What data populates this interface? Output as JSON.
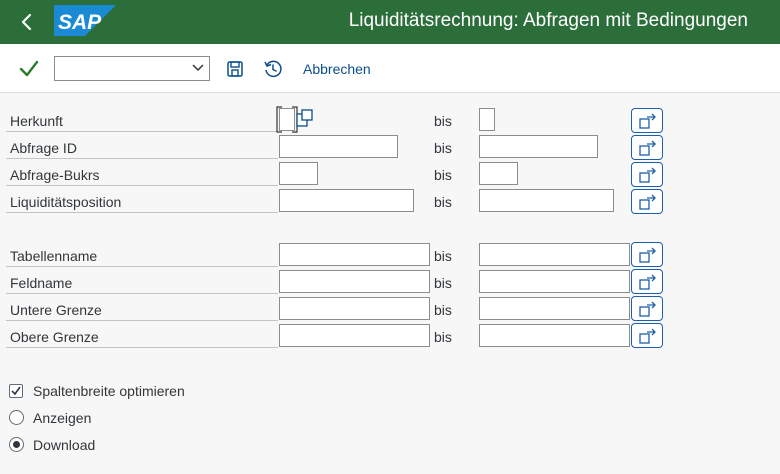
{
  "header": {
    "title": "Liquiditätsrechnung: Abfragen mit Bedingungen",
    "logo_text": "SAP"
  },
  "toolbar": {
    "variant_value": "",
    "cancel_label": "Abbrechen"
  },
  "range_label": "bis",
  "fields": {
    "herkunft": {
      "label": "Herkunft",
      "from": "",
      "to": ""
    },
    "abfrage_id": {
      "label": "Abfrage ID",
      "from": "",
      "to": ""
    },
    "abfrage_bukrs": {
      "label": "Abfrage-Bukrs",
      "from": "",
      "to": ""
    },
    "liquiditaetsposition": {
      "label": "Liquiditätsposition",
      "from": "",
      "to": ""
    },
    "tabellenname": {
      "label": "Tabellenname",
      "from": "",
      "to": ""
    },
    "feldname": {
      "label": "Feldname",
      "from": "",
      "to": ""
    },
    "untere_grenze": {
      "label": "Untere Grenze",
      "from": "",
      "to": ""
    },
    "obere_grenze": {
      "label": "Obere Grenze",
      "from": "",
      "to": ""
    }
  },
  "options": {
    "optimize_columns": {
      "label": "Spaltenbreite optimieren",
      "checked": true
    },
    "display": {
      "label": "Anzeigen",
      "selected": false
    },
    "download": {
      "label": "Download",
      "selected": true
    }
  },
  "colors": {
    "shell": "#2b6e3a",
    "accent": "#0a4e8c",
    "ok": "#2b7d2b"
  }
}
